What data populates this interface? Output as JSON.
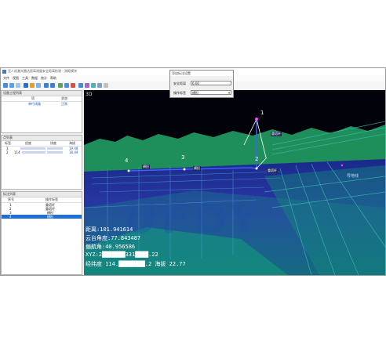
{
  "window": {
    "title": "无人机激光雷达距离测量安全距离检测 - 测距模块"
  },
  "menu": [
    "文件",
    "视图",
    "工具",
    "数据",
    "统计",
    "帮助"
  ],
  "project_panel": {
    "title": "设备工程列表",
    "columns": [
      "项",
      "状态"
    ],
    "rows": [
      {
        "name": "单行线路",
        "status": "正常"
      }
    ]
  },
  "point_list_panel": {
    "title": "点列表",
    "columns": [
      "标签",
      "经度",
      "纬度",
      "海拔"
    ],
    "rows": [
      {
        "id": "1",
        "lon": "",
        "lat": "",
        "alt": "19.48"
      },
      {
        "id": "2",
        "lon": "114",
        "lat": "",
        "alt": "18.49"
      }
    ]
  },
  "marker_panel": {
    "title": "标注列表",
    "columns": [
      "序号",
      "操作标签"
    ],
    "rows": [
      {
        "no": "1",
        "label": "重塔杆",
        "selected": false
      },
      {
        "no": "2",
        "label": "重塔杆",
        "selected": false
      },
      {
        "no": "3",
        "label": "横担",
        "selected": false
      },
      {
        "no": "4",
        "label": "横担",
        "selected": true
      }
    ]
  },
  "viewport": {
    "label": "3D",
    "points": [
      {
        "num": "1",
        "tag": "重塔杆"
      },
      {
        "num": "2",
        "tag": "重塔杆"
      },
      {
        "num": "3",
        "tag": "横担"
      },
      {
        "num": "4",
        "tag": "横担"
      }
    ],
    "side_tag": "导地线",
    "readouts": {
      "distance": "距离:101.941614",
      "pitch": "云台角度:77.843487",
      "yaw": "偏航角:40.956586",
      "xyz": "XYZ:2███████331████.22",
      "lonlat": "经纬度 114.████████.2 海拔 22.77"
    },
    "watermark": "UFDY"
  },
  "dialog": {
    "title": "添加标注设置",
    "field1_label": "安全距离",
    "field1_value": "6.00",
    "field2_label": "操作标签",
    "field2_value": "横担"
  }
}
